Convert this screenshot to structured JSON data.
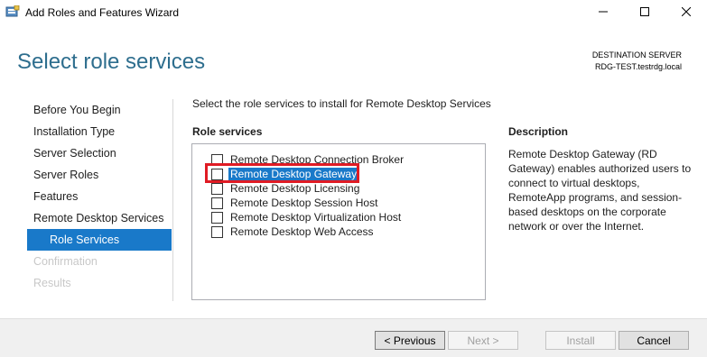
{
  "window": {
    "title": "Add Roles and Features Wizard"
  },
  "header": {
    "page_title": "Select role services",
    "destination_label": "DESTINATION SERVER",
    "destination_server": "RDG-TEST.testrdg.local"
  },
  "steps": [
    {
      "label": "Before You Begin",
      "state": "normal"
    },
    {
      "label": "Installation Type",
      "state": "normal"
    },
    {
      "label": "Server Selection",
      "state": "normal"
    },
    {
      "label": "Server Roles",
      "state": "normal"
    },
    {
      "label": "Features",
      "state": "normal"
    },
    {
      "label": "Remote Desktop Services",
      "state": "normal"
    },
    {
      "label": "Role Services",
      "state": "active"
    },
    {
      "label": "Confirmation",
      "state": "disabled"
    },
    {
      "label": "Results",
      "state": "disabled"
    }
  ],
  "main": {
    "instruction": "Select the role services to install for Remote Desktop Services",
    "role_services_heading": "Role services",
    "role_services": [
      {
        "label": "Remote Desktop Connection Broker",
        "checked": false
      },
      {
        "label": "Remote Desktop Gateway",
        "checked": false,
        "selected": true
      },
      {
        "label": "Remote Desktop Licensing",
        "checked": false
      },
      {
        "label": "Remote Desktop Session Host",
        "checked": false
      },
      {
        "label": "Remote Desktop Virtualization Host",
        "checked": false
      },
      {
        "label": "Remote Desktop Web Access",
        "checked": false
      }
    ],
    "description_heading": "Description",
    "description": "Remote Desktop Gateway (RD Gateway) enables authorized users to connect to virtual desktops, RemoteApp programs, and session-based desktops on the corporate network or over the Internet."
  },
  "footer": {
    "previous_label": "< Previous",
    "next_label": "Next >",
    "install_label": "Install",
    "cancel_label": "Cancel"
  },
  "colors": {
    "accent": "#1979c9",
    "title_blue": "#2e6e8e",
    "highlight_red": "#e01b24"
  },
  "icons": {
    "app": "server-manager-icon",
    "minimize": "minimize-icon",
    "maximize": "maximize-icon",
    "close": "close-icon"
  }
}
